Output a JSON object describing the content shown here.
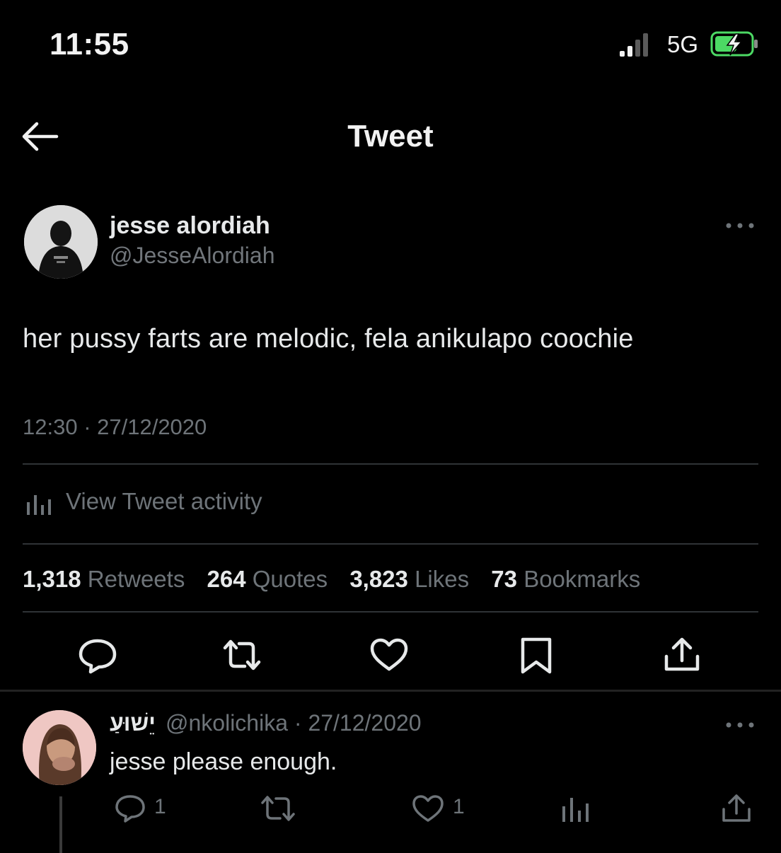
{
  "status_bar": {
    "time": "11:55",
    "network": "5G",
    "icons": [
      "signal-bars-icon",
      "battery-charging-icon"
    ]
  },
  "header": {
    "title": "Tweet",
    "back_icon": "arrow-left-icon"
  },
  "tweet": {
    "author_name": "jesse alordiah",
    "author_handle": "@JesseAlordiah",
    "text": "her pussy farts are melodic, fela anikulapo coochie",
    "timestamp": "12:30 · 27/12/2020",
    "activity_label": "View Tweet activity",
    "stats": [
      {
        "count": "1,318",
        "label": "Retweets"
      },
      {
        "count": "264",
        "label": "Quotes"
      },
      {
        "count": "3,823",
        "label": "Likes"
      },
      {
        "count": "73",
        "label": "Bookmarks"
      }
    ],
    "actions": [
      "reply-icon",
      "retweet-icon",
      "like-icon",
      "bookmark-icon",
      "share-icon"
    ]
  },
  "reply": {
    "author_name": "יֵשׁוּעַ",
    "meta": "@nkolichika · 27/12/2020",
    "text": "jesse please enough.",
    "reply_count": "1",
    "like_count": "1",
    "actions": [
      "reply-icon",
      "retweet-icon",
      "like-icon",
      "views-icon",
      "share-icon"
    ]
  },
  "colors": {
    "background": "#000000",
    "primary_text": "#e7e9ea",
    "secondary_text": "#6e7479",
    "divider": "#2f3336"
  }
}
